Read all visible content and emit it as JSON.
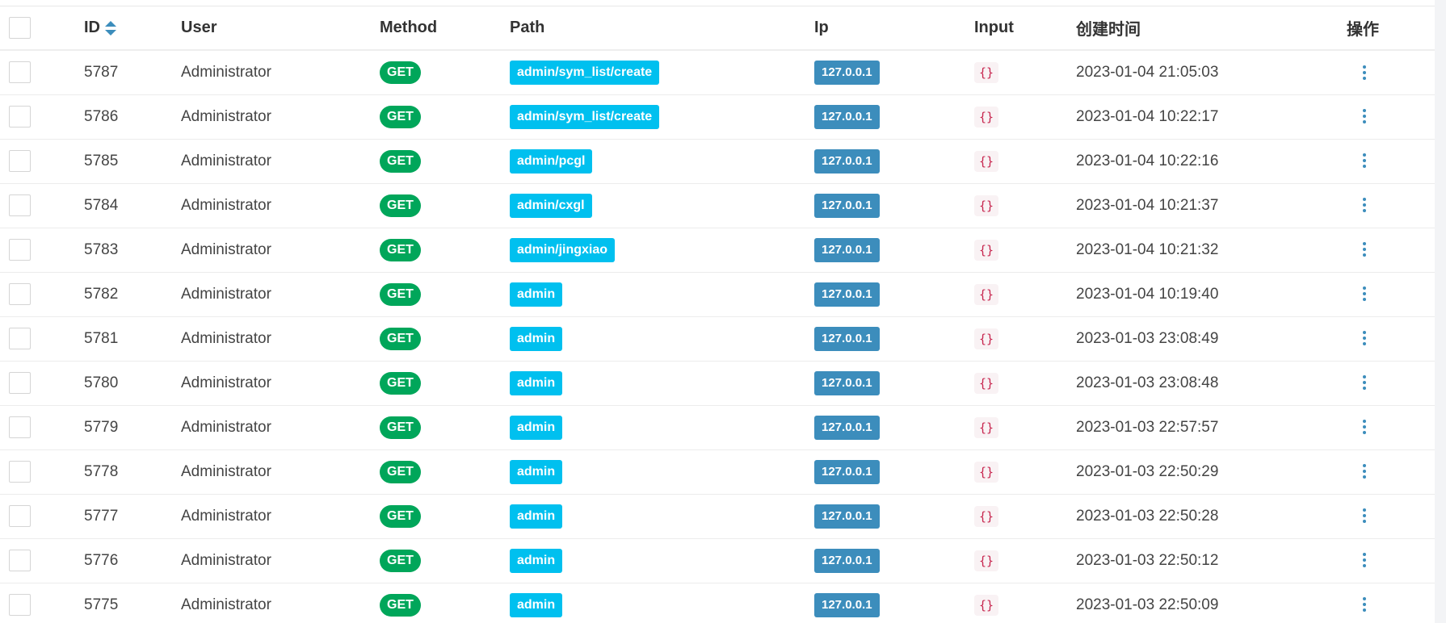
{
  "table": {
    "headers": {
      "id": "ID",
      "user": "User",
      "method": "Method",
      "path": "Path",
      "ip": "Ip",
      "input": "Input",
      "created_at": "创建时间",
      "actions": "操作"
    },
    "sort_icon": "sort-icon",
    "row_action_icon": "ellipsis-vertical-icon",
    "rows": [
      {
        "id": "5787",
        "user": "Administrator",
        "method": "GET",
        "path": "admin/sym_list/create",
        "ip": "127.0.0.1",
        "input": "{}",
        "created_at": "2023-01-04 21:05:03"
      },
      {
        "id": "5786",
        "user": "Administrator",
        "method": "GET",
        "path": "admin/sym_list/create",
        "ip": "127.0.0.1",
        "input": "{}",
        "created_at": "2023-01-04 10:22:17"
      },
      {
        "id": "5785",
        "user": "Administrator",
        "method": "GET",
        "path": "admin/pcgl",
        "ip": "127.0.0.1",
        "input": "{}",
        "created_at": "2023-01-04 10:22:16"
      },
      {
        "id": "5784",
        "user": "Administrator",
        "method": "GET",
        "path": "admin/cxgl",
        "ip": "127.0.0.1",
        "input": "{}",
        "created_at": "2023-01-04 10:21:37"
      },
      {
        "id": "5783",
        "user": "Administrator",
        "method": "GET",
        "path": "admin/jingxiao",
        "ip": "127.0.0.1",
        "input": "{}",
        "created_at": "2023-01-04 10:21:32"
      },
      {
        "id": "5782",
        "user": "Administrator",
        "method": "GET",
        "path": "admin",
        "ip": "127.0.0.1",
        "input": "{}",
        "created_at": "2023-01-04 10:19:40"
      },
      {
        "id": "5781",
        "user": "Administrator",
        "method": "GET",
        "path": "admin",
        "ip": "127.0.0.1",
        "input": "{}",
        "created_at": "2023-01-03 23:08:49"
      },
      {
        "id": "5780",
        "user": "Administrator",
        "method": "GET",
        "path": "admin",
        "ip": "127.0.0.1",
        "input": "{}",
        "created_at": "2023-01-03 23:08:48"
      },
      {
        "id": "5779",
        "user": "Administrator",
        "method": "GET",
        "path": "admin",
        "ip": "127.0.0.1",
        "input": "{}",
        "created_at": "2023-01-03 22:57:57"
      },
      {
        "id": "5778",
        "user": "Administrator",
        "method": "GET",
        "path": "admin",
        "ip": "127.0.0.1",
        "input": "{}",
        "created_at": "2023-01-03 22:50:29"
      },
      {
        "id": "5777",
        "user": "Administrator",
        "method": "GET",
        "path": "admin",
        "ip": "127.0.0.1",
        "input": "{}",
        "created_at": "2023-01-03 22:50:28"
      },
      {
        "id": "5776",
        "user": "Administrator",
        "method": "GET",
        "path": "admin",
        "ip": "127.0.0.1",
        "input": "{}",
        "created_at": "2023-01-03 22:50:12"
      },
      {
        "id": "5775",
        "user": "Administrator",
        "method": "GET",
        "path": "admin",
        "ip": "127.0.0.1",
        "input": "{}",
        "created_at": "2023-01-03 22:50:09"
      }
    ]
  },
  "colors": {
    "method_get": "#00a65a",
    "path_badge": "#00c0ef",
    "ip_badge": "#3c8dbc",
    "input_code_bg": "#f9f2f4",
    "input_code_text": "#c7254e",
    "sort_and_action_accent": "#3c8dbc"
  }
}
